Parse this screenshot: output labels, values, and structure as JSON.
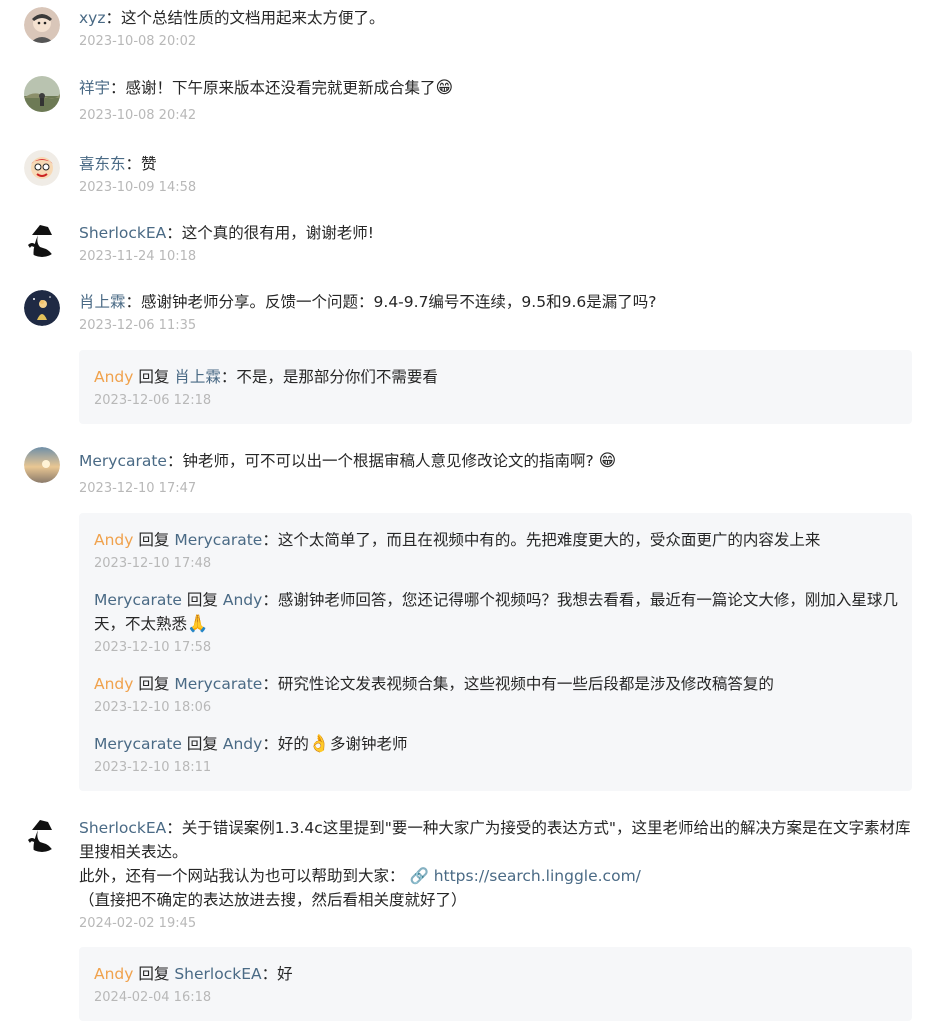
{
  "comments": [
    {
      "name": "xyz",
      "sep": "：",
      "text": "这个总结性质的文档用起来太方便了。",
      "emoji": "",
      "time": "2023-10-08 20:02"
    },
    {
      "name": "祥宇",
      "sep": "：",
      "text": "感谢！下午原来版本还没看完就更新成合集了",
      "emoji": "😁",
      "time": "2023-10-08 20:42"
    },
    {
      "name": "喜东东",
      "sep": "：",
      "text": "赞",
      "emoji": "",
      "time": "2023-10-09 14:58"
    },
    {
      "name": "SherlockEA",
      "sep": "：",
      "text": "这个真的很有用，谢谢老师!",
      "emoji": "",
      "time": "2023-11-24 10:18"
    },
    {
      "name": "肖上霖",
      "sep": "：",
      "text": "感谢钟老师分享。反馈一个问题：9.4-9.7编号不连续，9.5和9.6是漏了吗?",
      "emoji": "",
      "time": "2023-12-06 11:35",
      "replies": [
        {
          "from": "Andy",
          "reply_word": "回复",
          "to": "肖上霖",
          "sep": "：",
          "text": "不是，是那部分你们不需要看",
          "time": "2023-12-06 12:18"
        }
      ]
    },
    {
      "name": "Merycarate",
      "sep": "：",
      "text": "钟老师，可不可以出一个根据审稿人意见修改论文的指南啊?",
      "emoji": "😁",
      "time": "2023-12-10 17:47",
      "replies": [
        {
          "from": "Andy",
          "reply_word": "回复",
          "to": "Merycarate",
          "sep": "：",
          "text": "这个太简单了，而且在视频中有的。先把难度更大的，受众面更广的内容发上来",
          "time": "2023-12-10 17:48"
        },
        {
          "from": "Merycarate",
          "reply_word": "回复",
          "to": "Andy",
          "sep": "：",
          "text": "感谢钟老师回答，您还记得哪个视频吗？我想去看看，最近有一篇论文大修，刚加入星球几天，不太熟悉",
          "emoji": "🙏",
          "time": "2023-12-10 17:58"
        },
        {
          "from": "Andy",
          "reply_word": "回复",
          "to": "Merycarate",
          "sep": "：",
          "text": "研究性论文发表视频合集，这些视频中有一些后段都是涉及修改稿答复的",
          "time": "2023-12-10 18:06"
        },
        {
          "from": "Merycarate",
          "reply_word": "回复",
          "to": "Andy",
          "sep": "：",
          "text": "好的",
          "emoji": "👌",
          "text2": "多谢钟老师",
          "time": "2023-12-10 18:11"
        }
      ]
    },
    {
      "name": "SherlockEA",
      "sep": "：",
      "text": "关于错误案例1.3.4c这里提到\"要一种大家广为接受的表达方式\"，这里老师给出的解决方案是在文字素材库里搜相关表达。",
      "line2": "此外，还有一个网站我认为也可以帮助到大家：",
      "link": "https://search.linggle.com/",
      "line3": "（直接把不确定的表达放进去搜，然后看相关度就好了）",
      "time": "2024-02-02 19:45",
      "replies": [
        {
          "from": "Andy",
          "reply_word": "回复",
          "to": "SherlockEA",
          "sep": "：",
          "text": "好",
          "time": "2024-02-04 16:18"
        }
      ]
    }
  ],
  "icons": {
    "link": "link-icon"
  }
}
